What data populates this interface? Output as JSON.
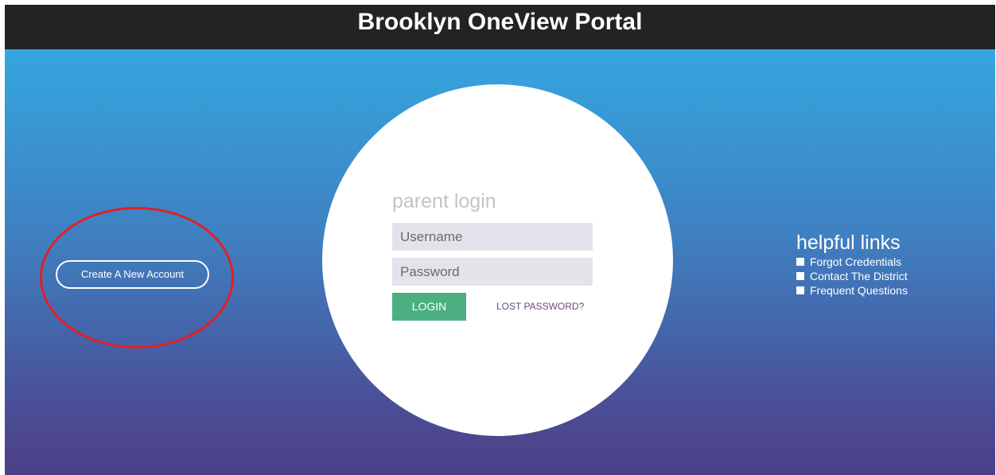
{
  "header": {
    "title": "Brooklyn OneView Portal"
  },
  "left": {
    "create_account_label": "Create A New Account"
  },
  "login": {
    "title": "parent login",
    "username_placeholder": "Username",
    "password_placeholder": "Password",
    "login_label": "LOGIN",
    "lost_password_label": "LOST PASSWORD?"
  },
  "helpful": {
    "title": "helpful links",
    "items": [
      "Forgot Credentials",
      "Contact The District",
      "Frequent Questions"
    ]
  },
  "colors": {
    "header_bg": "#232323",
    "gradient_top": "#35a6df",
    "gradient_bottom": "#4d3f86",
    "login_button": "#4caf82",
    "annotation_red": "#e21f26"
  }
}
